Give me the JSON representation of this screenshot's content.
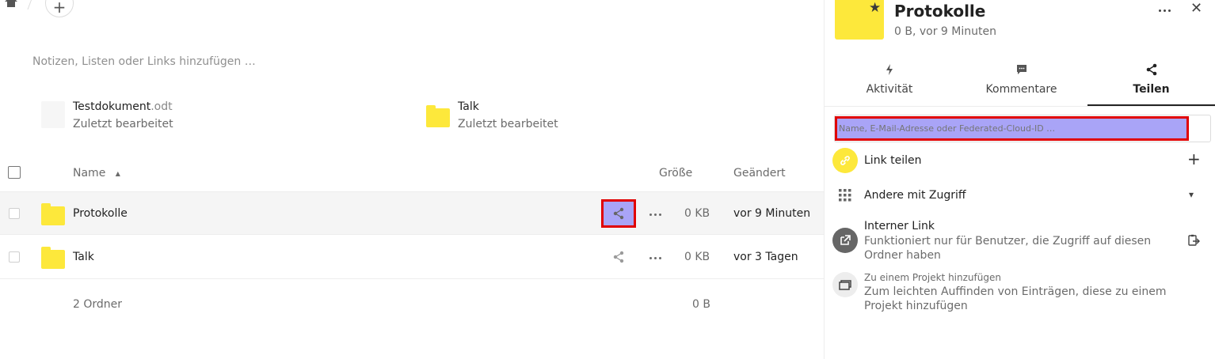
{
  "toolbar": {
    "home_icon": "home-icon",
    "add_icon": "plus-icon",
    "add_glyph": "+"
  },
  "notes_placeholder": "Notizen, Listen oder Links hinzufügen …",
  "recent": [
    {
      "name": "Testdokument",
      "ext": ".odt",
      "sub": "Zuletzt bearbeitet",
      "icon": "document-icon"
    },
    {
      "name": "Talk",
      "ext": "",
      "sub": "Zuletzt bearbeitet",
      "icon": "folder-icon"
    }
  ],
  "table": {
    "headers": {
      "name": "Name",
      "size": "Größe",
      "modified": "Geändert"
    },
    "rows": [
      {
        "name": "Protokolle",
        "size": "0 KB",
        "modified": "vor 9 Minuten",
        "highlighted": true
      },
      {
        "name": "Talk",
        "size": "0 KB",
        "modified": "vor 3 Tagen",
        "highlighted": false
      }
    ],
    "summary": {
      "label": "2 Ordner",
      "size": "0 B"
    }
  },
  "sidebar": {
    "title": "Protokolle",
    "subtitle": "0 B, vor 9 Minuten",
    "close_glyph": "✕",
    "tabs": [
      {
        "label": "Aktivität",
        "icon": "activity-icon"
      },
      {
        "label": "Kommentare",
        "icon": "comment-icon"
      },
      {
        "label": "Teilen",
        "icon": "share-icon",
        "active": true
      }
    ],
    "share_placeholder": "Name, E-Mail-Adresse oder Federated-Cloud-ID …",
    "link_share": {
      "label": "Link teilen",
      "add_glyph": "+"
    },
    "others": {
      "label": "Andere mit Zugriff",
      "caret_glyph": "▾"
    },
    "internal": {
      "title": "Interner Link",
      "desc": "Funktioniert nur für Benutzer, die Zugriff auf diesen Ordner haben"
    },
    "project": {
      "title": "Zu einem Projekt hinzufügen",
      "desc": "Zum leichten Auffinden von Einträgen, diese zu einem Projekt hinzufügen"
    }
  },
  "colors": {
    "folder": "#fde83b",
    "highlight": "#a9a4f7",
    "marker": "#e00000",
    "link_circle": "#fde83b"
  }
}
